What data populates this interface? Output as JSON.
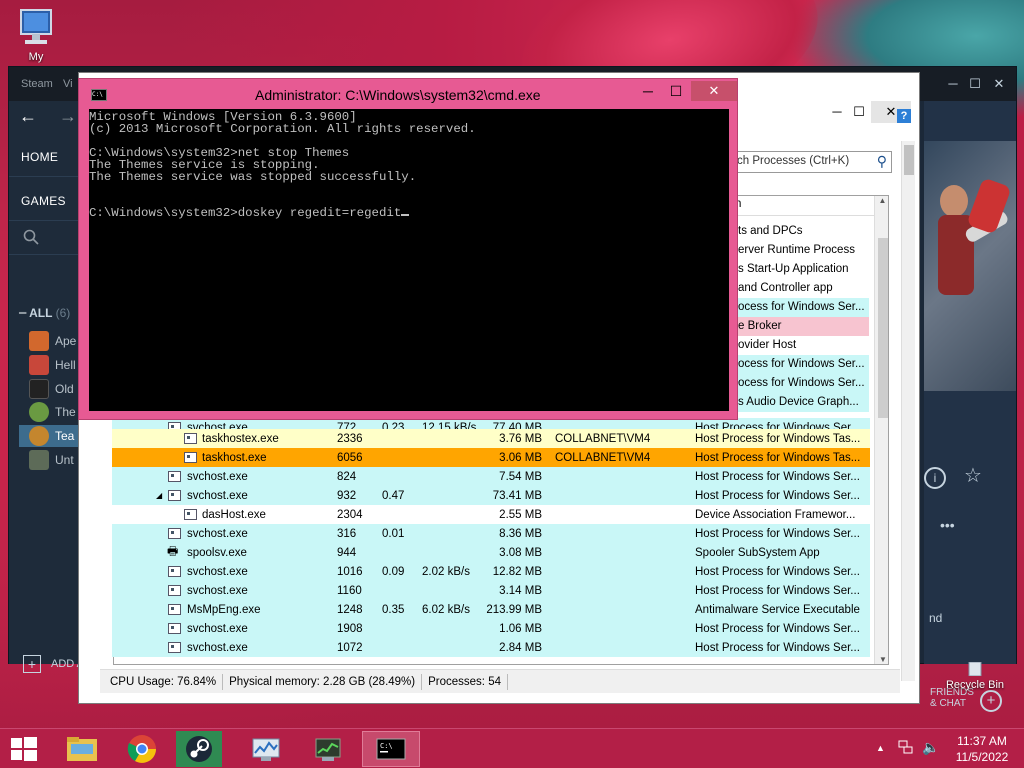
{
  "desktop": {
    "icons": [
      {
        "label": "My Computer"
      },
      {
        "label": "Recycle Bin"
      }
    ]
  },
  "steam": {
    "menu_items": [
      "Steam",
      "Vi"
    ],
    "nav": {
      "home": "HOME",
      "games": "GAMES"
    },
    "filter_label": "ALL",
    "filter_count": "(6)",
    "games": [
      {
        "label": "Ape",
        "color": "#d2682d"
      },
      {
        "label": "Hell",
        "color": "#c8473a"
      },
      {
        "label": "Old",
        "color": "#222222"
      },
      {
        "label": "The",
        "color": "#6a9a42"
      },
      {
        "label": "Tea",
        "color": "#c4862e"
      },
      {
        "label": "Unt",
        "color": "#5d6b58"
      }
    ],
    "add_label": "ADD A",
    "right_partial_text": "nd",
    "friends_label_1": "FRIENDS",
    "friends_label_2": "& CHAT"
  },
  "task_manager": {
    "search_placeholder": "ch Processes (Ctrl+K)",
    "header_partial": "ion",
    "desc_rows_top": [
      "ts and DPCs",
      "erver Runtime Process",
      "s Start-Up Application",
      " and Controller app",
      "ocess for Windows Ser...",
      "e Broker",
      "ovider Host",
      "ocess for Windows Ser...",
      "ocess for Windows Ser...",
      "s Audio Device Graph..."
    ],
    "rows": [
      {
        "name": "svchost.exe",
        "pid": "772",
        "cpu": "0.23",
        "io": "12.15 kB/s",
        "mem": "77.40 MB",
        "user": "",
        "desc": "Host Process for Windows Ser...",
        "bg": "#c9f7f7",
        "indent": 0
      },
      {
        "name": "taskhostex.exe",
        "pid": "2336",
        "cpu": "",
        "io": "",
        "mem": "3.76 MB",
        "user": "COLLABNET\\VM4",
        "desc": "Host Process for Windows Tas...",
        "bg": "#ffffc8",
        "indent": 1
      },
      {
        "name": "taskhost.exe",
        "pid": "6056",
        "cpu": "",
        "io": "",
        "mem": "3.06 MB",
        "user": "COLLABNET\\VM4",
        "desc": "Host Process for Windows Tas...",
        "bg": "#ffa500",
        "indent": 1
      },
      {
        "name": "svchost.exe",
        "pid": "824",
        "cpu": "",
        "io": "",
        "mem": "7.54 MB",
        "user": "",
        "desc": "Host Process for Windows Ser...",
        "bg": "#c9f7f7",
        "indent": 0
      },
      {
        "name": "svchost.exe",
        "pid": "932",
        "cpu": "0.47",
        "io": "",
        "mem": "73.41 MB",
        "user": "",
        "desc": "Host Process for Windows Ser...",
        "bg": "#c9f7f7",
        "indent": 0
      },
      {
        "name": "dasHost.exe",
        "pid": "2304",
        "cpu": "",
        "io": "",
        "mem": "2.55 MB",
        "user": "",
        "desc": "Device Association Framewor...",
        "bg": "#ffffff",
        "indent": 1
      },
      {
        "name": "svchost.exe",
        "pid": "316",
        "cpu": "0.01",
        "io": "",
        "mem": "8.36 MB",
        "user": "",
        "desc": "Host Process for Windows Ser...",
        "bg": "#c9f7f7",
        "indent": 0
      },
      {
        "name": "spoolsv.exe",
        "pid": "944",
        "cpu": "",
        "io": "",
        "mem": "3.08 MB",
        "user": "",
        "desc": "Spooler SubSystem App",
        "bg": "#c9f7f7",
        "indent": 0
      },
      {
        "name": "svchost.exe",
        "pid": "1016",
        "cpu": "0.09",
        "io": "2.02 kB/s",
        "mem": "12.82 MB",
        "user": "",
        "desc": "Host Process for Windows Ser...",
        "bg": "#c9f7f7",
        "indent": 0
      },
      {
        "name": "svchost.exe",
        "pid": "1160",
        "cpu": "",
        "io": "",
        "mem": "3.14 MB",
        "user": "",
        "desc": "Host Process for Windows Ser...",
        "bg": "#c9f7f7",
        "indent": 0
      },
      {
        "name": "MsMpEng.exe",
        "pid": "1248",
        "cpu": "0.35",
        "io": "6.02 kB/s",
        "mem": "213.99 MB",
        "user": "",
        "desc": "Antimalware Service Executable",
        "bg": "#c9f7f7",
        "indent": 0
      },
      {
        "name": "svchost.exe",
        "pid": "1908",
        "cpu": "",
        "io": "",
        "mem": "1.06 MB",
        "user": "",
        "desc": "Host Process for Windows Ser...",
        "bg": "#c9f7f7",
        "indent": 0
      },
      {
        "name": "svchost.exe",
        "pid": "1072",
        "cpu": "",
        "io": "",
        "mem": "2.84 MB",
        "user": "",
        "desc": "Host Process for Windows Ser...",
        "bg": "#c9f7f7",
        "indent": 0
      }
    ],
    "status": {
      "cpu": "CPU Usage: 76.84%",
      "memory": "Physical memory: 2.28 GB (28.49%)",
      "processes": "Processes: 54"
    }
  },
  "cmd": {
    "title": "Administrator: C:\\Windows\\system32\\cmd.exe",
    "lines": [
      "Microsoft Windows [Version 6.3.9600]",
      "(c) 2013 Microsoft Corporation. All rights reserved.",
      "",
      "C:\\Windows\\system32>net stop Themes",
      "The Themes service is stopping.",
      "The Themes service was stopped successfully.",
      "",
      "",
      "C:\\Windows\\system32>doskey regedit=regedit"
    ]
  },
  "taskbar": {
    "time": "11:37 AM",
    "date": "11/5/2022",
    "apps": [
      "start",
      "file-explorer",
      "chrome",
      "steam",
      "resource-monitor",
      "process-explorer",
      "cmd"
    ]
  }
}
